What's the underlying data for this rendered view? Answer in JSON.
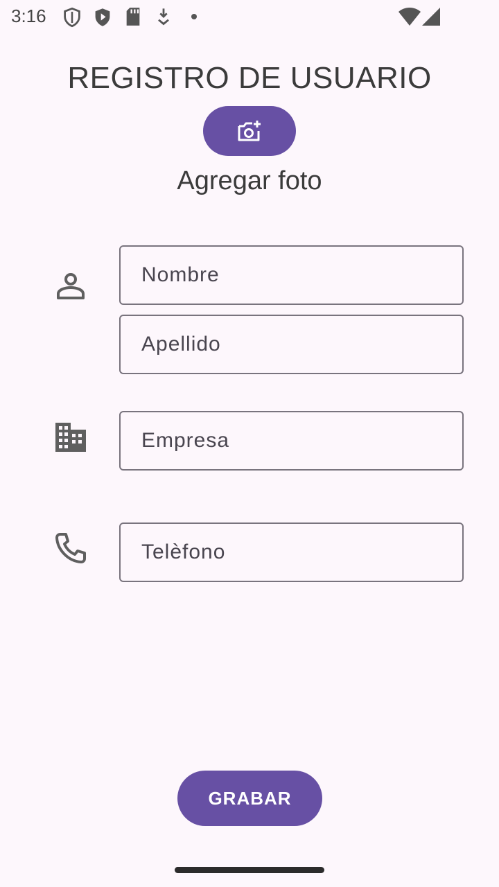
{
  "status_bar": {
    "time": "3:16",
    "icons": [
      "shield-icon",
      "play-protect-icon",
      "sd-card-icon",
      "download-icon",
      "dot-icon",
      "wifi-icon",
      "signal-icon"
    ]
  },
  "title": "REGISTRO DE USUARIO",
  "photo": {
    "icon": "add-photo-icon",
    "label": "Agregar foto"
  },
  "form": {
    "nombre_placeholder": "Nombre",
    "apellido_placeholder": "Apellido",
    "empresa_placeholder": "Empresa",
    "telefono_placeholder": "Telèfono",
    "icons": {
      "person": "person-icon",
      "company": "building-icon",
      "phone": "phone-icon"
    }
  },
  "save_label": "GRABAR",
  "colors": {
    "accent": "#6750a4",
    "background": "#fdf7fc",
    "outline": "#79747e",
    "icon": "#5f5f5f"
  }
}
